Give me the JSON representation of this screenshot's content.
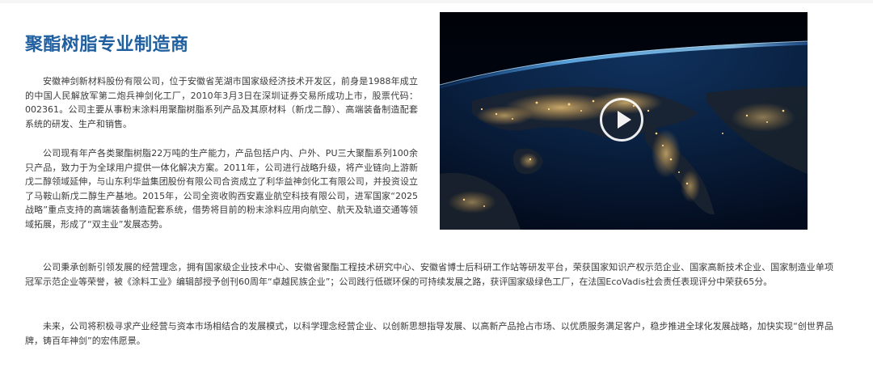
{
  "heading": {
    "title": "聚酯树脂专业制造商"
  },
  "intro": {
    "paragraph_1": "安徽神剑新材料股份有限公司，位于安徽省芜湖市国家级经济技术开发区，前身是1988年成立的中国人民解放军第二炮兵神剑化工厂，2010年3月3日在深圳证券交易所成功上市，股票代码：002361。公司主要从事粉末涂料用聚酯树脂系列产品及其原材料（新戊二醇）、高端装备制造配套系统的研发、生产和销售。",
    "paragraph_2": "公司现有年产各类聚酯树脂22万吨的生产能力，产品包括户内、户外、PU三大聚酯系列100余只产品，致力于为全球用户提供一体化解决方案。2011年，公司进行战略升级，将产业链向上游新戊二醇领域延伸，与山东利华益集团股份有限公司合资成立了利华益神剑化工有限公司，并投资设立了马鞍山新戊二醇生产基地。2015年，公司全资收购西安嘉业航空科技有限公司，进军国家“2025战略”重点支持的高端装备制造配套系统，借势将目前的粉末涂料应用向航空、航天及轨道交通等领域拓展，形成了“双主业”发展态势。"
  },
  "body": {
    "paragraph_3": "公司秉承创新引领发展的经营理念，拥有国家级企业技术中心、安徽省聚酯工程技术研究中心、安徽省博士后科研工作站等研发平台，荣获国家知识产权示范企业、国家高新技术企业、国家制造业单项冠军示范企业等荣誉，被《涂料工业》编辑部授予创刊60周年“卓越民族企业”；公司践行低碳环保的可持续发展之路，获评国家级绿色工厂，在法国EcoVadis社会责任表现评分中荣获65分。",
    "paragraph_4": "未来，公司将积极寻求产业经营与资本市场相结合的发展模式，以科学理念经营企业、以创新思想指导发展、以高新产品抢占市场、以优质服务满足客户，稳步推进全球化发展战略，加快实现“创世界品牌，铸百年神剑”的宏伟愿景。"
  },
  "video": {
    "thumbnail_icon": "earth-at-night-from-orbit",
    "play_icon": "play-icon"
  },
  "colors": {
    "title": "#1f5fa0",
    "text": "#3a3a3a",
    "atmosphere": "#4aa8ff",
    "city_lights": "#ffc766"
  }
}
